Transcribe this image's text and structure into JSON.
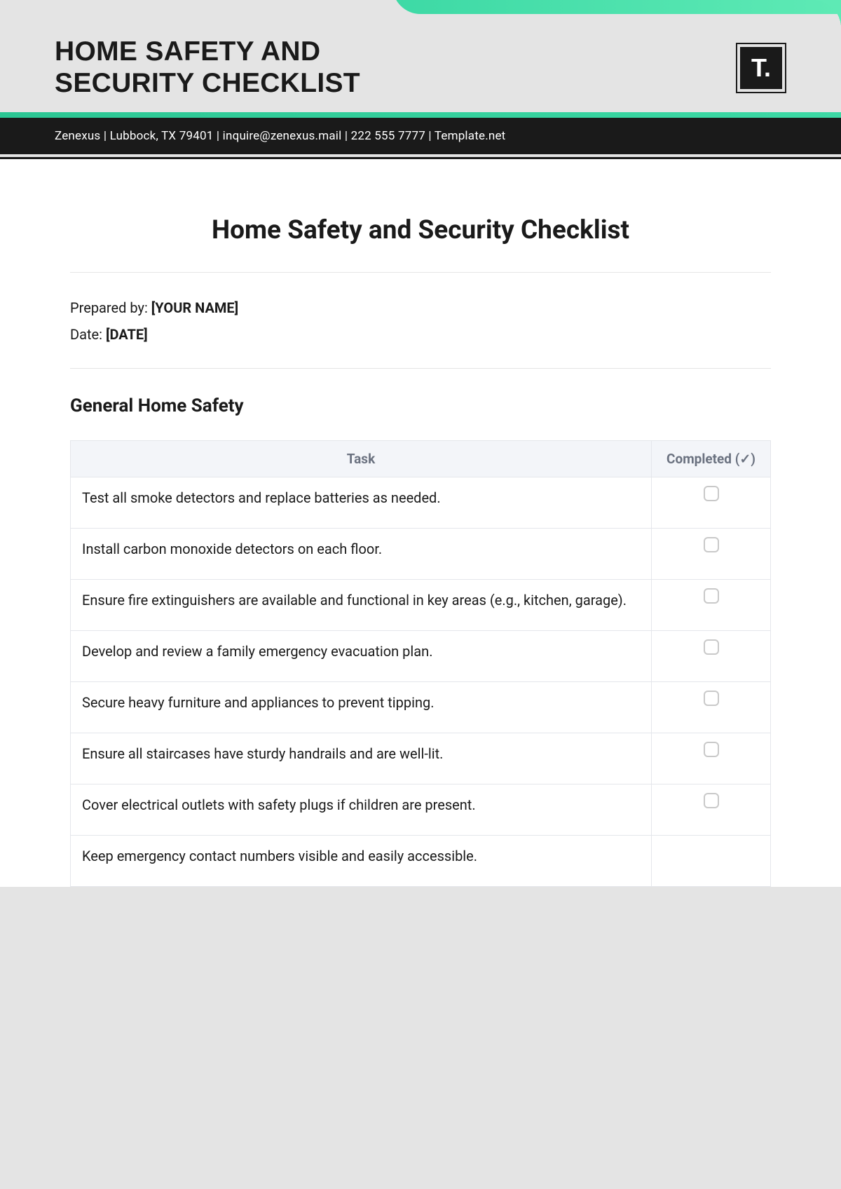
{
  "header": {
    "title_line1": "HOME SAFETY AND",
    "title_line2": "SECURITY CHECKLIST",
    "logo_text": "T.",
    "info_bar": "Zenexus | Lubbock, TX 79401 | inquire@zenexus.mail | 222 555 7777 | Template.net"
  },
  "document": {
    "title": "Home Safety and Security Checklist",
    "prepared_by_label": "Prepared by: ",
    "prepared_by_value": "[YOUR NAME]",
    "date_label": "Date: ",
    "date_value": "[DATE]"
  },
  "section": {
    "title": "General Home Safety",
    "columns": {
      "task": "Task",
      "completed": "Completed (✓)"
    },
    "tasks": [
      "Test all smoke detectors and replace batteries as needed.",
      "Install carbon monoxide detectors on each floor.",
      "Ensure fire extinguishers are available and functional in key areas (e.g., kitchen, garage).",
      "Develop and review a family emergency evacuation plan.",
      "Secure heavy furniture and appliances to prevent tipping.",
      "Ensure all staircases have sturdy handrails and are well-lit.",
      "Cover electrical outlets with safety plugs if children are present.",
      "Keep emergency contact numbers visible and easily accessible."
    ]
  }
}
